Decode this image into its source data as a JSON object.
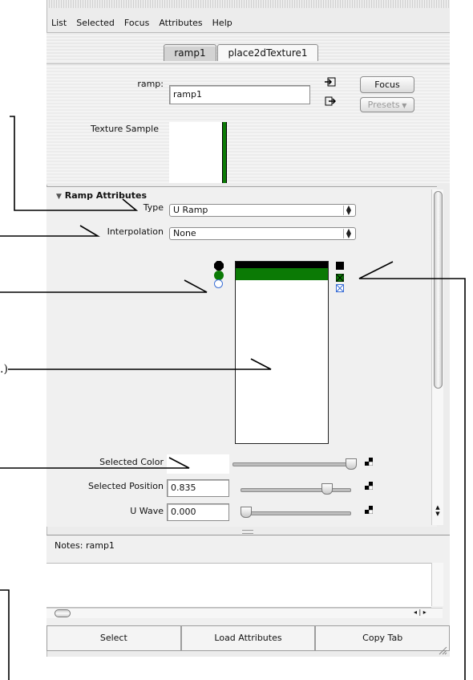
{
  "menu": [
    "List",
    "Selected",
    "Focus",
    "Attributes",
    "Help"
  ],
  "tabs": [
    {
      "label": "ramp1",
      "active": true
    },
    {
      "label": "place2dTexture1",
      "active": false
    }
  ],
  "ramp_field": {
    "label": "ramp:",
    "value": "ramp1"
  },
  "buttons": {
    "focus": "Focus",
    "presets": "Presets"
  },
  "texture_sample_label": "Texture Sample",
  "section_title": "Ramp Attributes",
  "type": {
    "label": "Type",
    "value": "U Ramp"
  },
  "interpolation": {
    "label": "Interpolation",
    "value": "None"
  },
  "selected_color": {
    "label": "Selected Color",
    "slider_level": 0.97
  },
  "selected_position": {
    "label": "Selected Position",
    "value": "0.835",
    "slider_level": 0.82
  },
  "u_wave": {
    "label": "U Wave",
    "value": "0.000",
    "slider_level": 0.0
  },
  "notes_label": "Notes: ramp1",
  "bottom_buttons": [
    "Select",
    "Load Attributes",
    "Copy Tab"
  ],
  "colors": {
    "ramp_green": "#0b7a05",
    "ramp_black": "#000000",
    "handle_blue": "#3b6fd6"
  },
  "annotation_fragment": ".)"
}
